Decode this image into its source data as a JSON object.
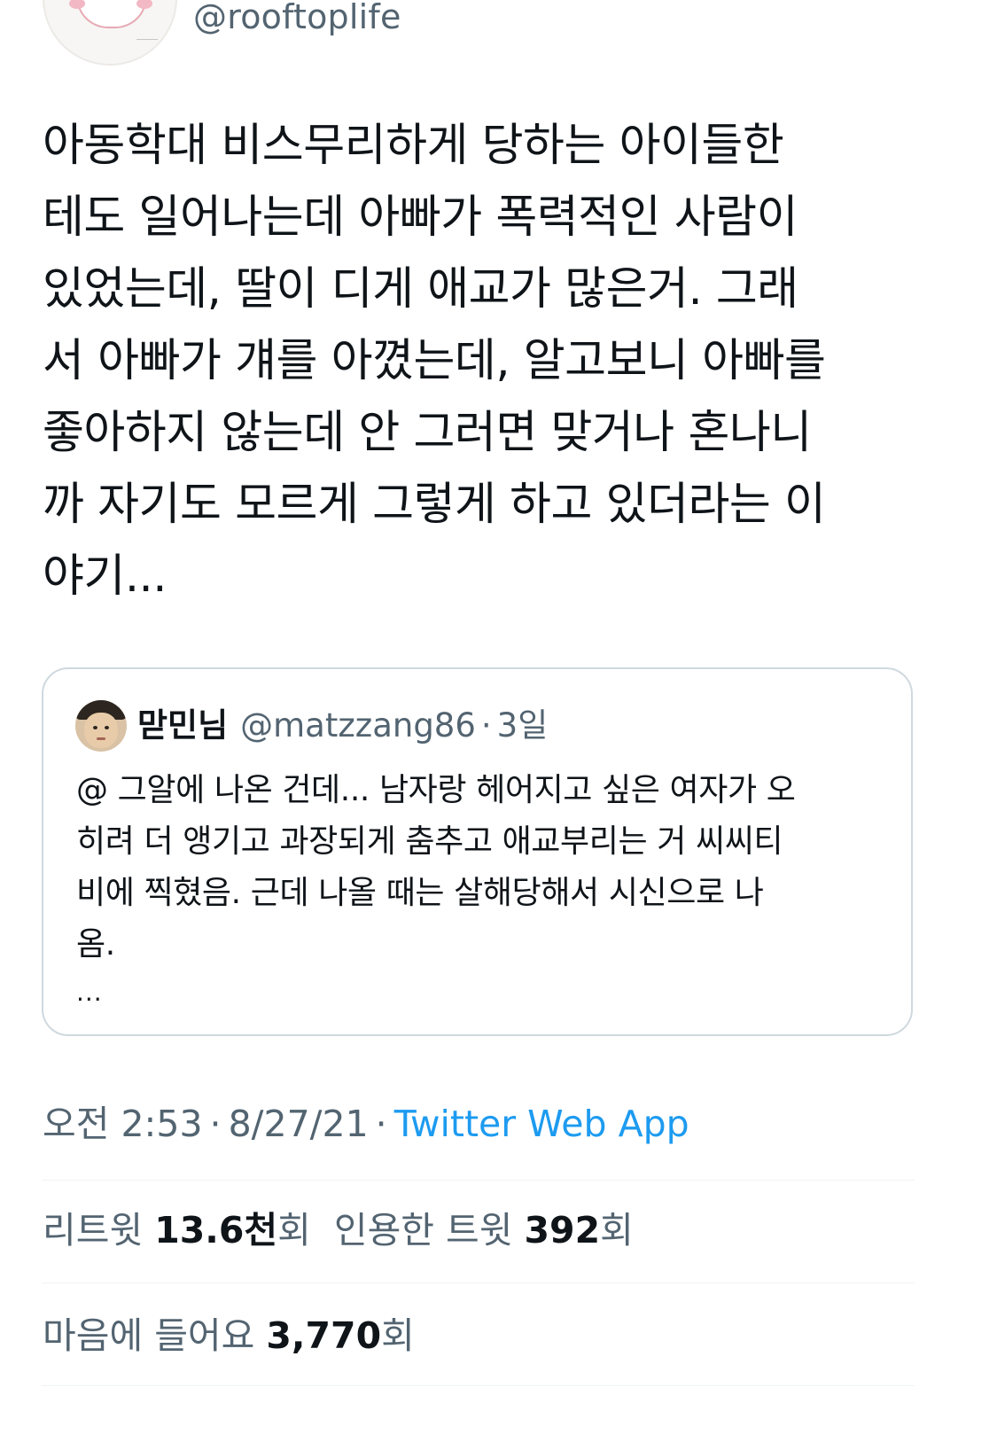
{
  "tweet": {
    "handle": "@rooftoplife",
    "text": "아동학대 비스무리하게 당하는 아이들한\n테도 일어나는데 아빠가 폭력적인 사람이\n있었는데, 딸이 디게 애교가 많은거. 그래\n서 아빠가 걔를 아꼈는데, 알고보니 아빠를\n좋아하지 않는데 안 그러면 맞거나 혼나니\n까 자기도 모르게 그렇게 하고 있더라는 이\n야기..."
  },
  "quote": {
    "name": "맏민님",
    "handle": "@matzzang86",
    "dot": "·",
    "time": "3일",
    "text": "@ 그알에 나온 건데... 남자랑 헤어지고 싶은 여자가 오\n히려 더 앵기고 과장되게 춤추고 애교부리는 거 씨씨티\n비에 찍혔음. 근데 나올 때는 살해당해서 시신으로 나\n옴.",
    "ellipsis": "..."
  },
  "meta": {
    "time": "오전 2:53",
    "date": "8/27/21",
    "source": "Twitter Web App",
    "sep": "·"
  },
  "stats": {
    "retweet_label": "리트윗",
    "retweet_count": "13.6천",
    "retweet_suffix": "회",
    "quote_label": "인용한 트윗",
    "quote_count": "392",
    "quote_suffix": "회",
    "like_label": "마음에 들어요",
    "like_count": "3,770",
    "like_suffix": "회"
  },
  "colors": {
    "text_primary": "#0f1419",
    "text_secondary": "#536471",
    "link": "#1d9bf0",
    "border": "#cfd9de"
  }
}
